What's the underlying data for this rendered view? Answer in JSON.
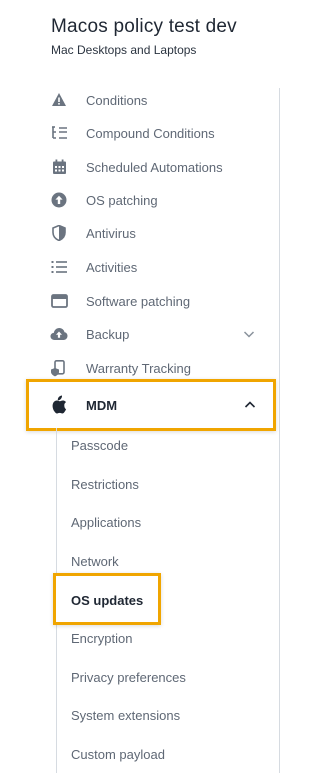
{
  "header": {
    "title": "Macos policy test dev",
    "subtitle": "Mac Desktops and Laptops"
  },
  "nav": {
    "conditions": "Conditions",
    "compound_conditions": "Compound Conditions",
    "scheduled_automations": "Scheduled Automations",
    "os_patching": "OS patching",
    "antivirus": "Antivirus",
    "activities": "Activities",
    "software_patching": "Software patching",
    "backup": "Backup",
    "warranty_tracking": "Warranty Tracking",
    "mdm": "MDM"
  },
  "mdm_sub": {
    "passcode": "Passcode",
    "restrictions": "Restrictions",
    "applications": "Applications",
    "network": "Network",
    "os_updates": "OS updates",
    "encryption": "Encryption",
    "privacy_preferences": "Privacy preferences",
    "system_extensions": "System extensions",
    "custom_payload": "Custom payload"
  },
  "colors": {
    "highlight": "#f0a500",
    "icon": "#6b7480",
    "text": "#5f6875"
  }
}
